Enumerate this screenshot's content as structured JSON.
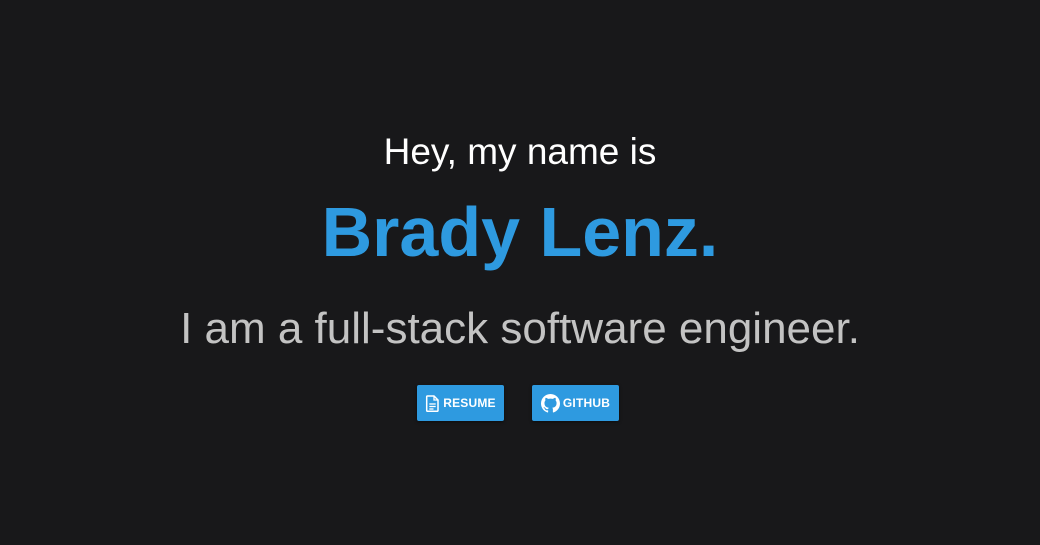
{
  "hero": {
    "intro": "Hey, my name is",
    "name": "Brady Lenz.",
    "tagline": "I am a full-stack software engineer."
  },
  "buttons": {
    "resume": {
      "label": "RESUME",
      "icon": "document-icon"
    },
    "github": {
      "label": "GITHUB",
      "icon": "github-icon"
    }
  },
  "colors": {
    "background": "#18181a",
    "accent": "#2e9ae0",
    "intro_text": "#ffffff",
    "tagline_text": "#c3c3c3"
  }
}
